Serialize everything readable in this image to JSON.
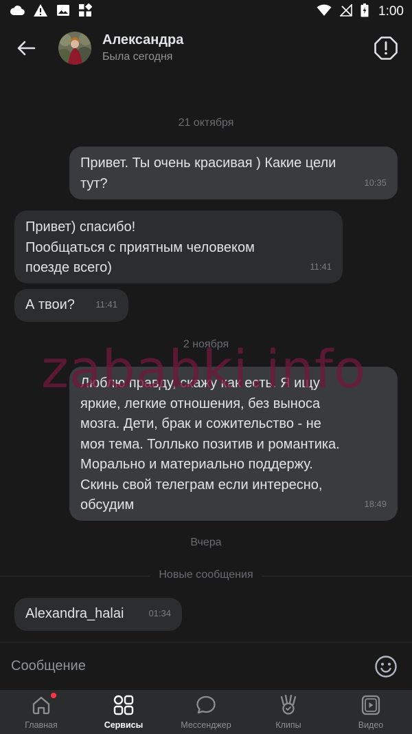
{
  "status_bar": {
    "time": "1:00"
  },
  "header": {
    "name": "Александра",
    "status": "Была сегодня"
  },
  "chat": {
    "date_1": "21 октября",
    "date_2": "2 ноября",
    "date_3": "Вчера",
    "new_messages_label": "Новые сообщения",
    "messages": [
      {
        "direction": "outgoing",
        "text": "Привет. Ты очень красивая ) Какие цели\nтут?",
        "time": "10:35"
      },
      {
        "direction": "incoming",
        "text": "Привет) спасибо!\nПообщаться с приятным человеком\nпоезде всего)",
        "time": "11:41"
      },
      {
        "direction": "incoming",
        "text": "А твои?",
        "time": "11:41"
      },
      {
        "direction": "outgoing",
        "text": "Люблю правду, скажу как есть. Я ищу\nяркие, легкие отношения, без выноса\nмозга. Дети, брак и сожительство - не\nмоя тема. Толлько позитив и романтика.\nМорально и материально поддержу.\nСкинь свой телеграм если интересно,\nобсудим",
        "time": "18:49"
      },
      {
        "direction": "incoming",
        "text": "Alexandra_halai",
        "time": "01:34"
      }
    ]
  },
  "watermark": "zababki.info",
  "composer": {
    "placeholder": "Сообщение"
  },
  "tabbar": {
    "tabs": [
      {
        "label": "Главная",
        "icon": "home-icon",
        "badge": true
      },
      {
        "label": "Сервисы",
        "icon": "services-icon",
        "active": true
      },
      {
        "label": "Мессенджер",
        "icon": "messenger-icon"
      },
      {
        "label": "Клипы",
        "icon": "clips-icon"
      },
      {
        "label": "Видео",
        "icon": "video-icon"
      }
    ]
  },
  "colors": {
    "background": "#19191a",
    "bubble_outgoing": "#3a3b3e",
    "bubble_incoming": "#2c2d2f",
    "tabbar": "#2b2c2e",
    "badge": "#ff3347",
    "watermark": "#6e183a"
  }
}
